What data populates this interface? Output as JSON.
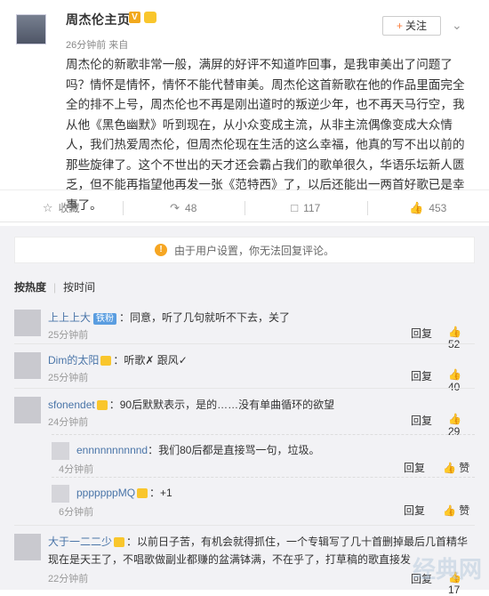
{
  "post": {
    "username": "周杰伦主页",
    "v_badge": "V",
    "meta": "26分钟前 来自",
    "follow_label": "关注",
    "text": "周杰伦的新歌非常一般，满屏的好评不知道咋回事，是我审美出了问题了吗？情怀是情怀，情怀不能代替审美。周杰伦这首新歌在他的作品里面完全全的排不上号，周杰伦也不再是刚出道时的叛逆少年，也不再天马行空，我从他《黑色幽默》听到现在，从小众变成主流，从非主流偶像变成大众情人，我们热爱周杰伦，但周杰伦现在生活的这么幸福，他真的写不出以前的那些旋律了。这个不世出的天才还会霸占我们的歌单很久，华语乐坛新人匮乏，但不能再指望他再发一张《范特西》了，以后还能出一两首好歌已是幸事了。"
  },
  "actions": {
    "favorite": "收藏",
    "repost": "48",
    "comment": "117",
    "like": "453"
  },
  "notice": "由于用户设置，你无法回复评论。",
  "sort": {
    "hot": "按热度",
    "time": "按时间"
  },
  "comments": [
    {
      "name": "上上上大",
      "badge": "铁粉",
      "text": "：同意，听了几句就听不下去，关了",
      "time": "25分钟前",
      "reply": "回复",
      "likes": "52"
    },
    {
      "name": "Dim的太阳",
      "text": "：听歌✗ 跟风✓",
      "time": "25分钟前",
      "reply": "回复",
      "likes": "40"
    },
    {
      "name": "sfonendet",
      "text": "：90后默默表示，是的……没有单曲循环的欲望",
      "time": "24分钟前",
      "reply": "回复",
      "likes": "29"
    },
    {
      "name": "大于一二二少",
      "text": "：以前日子苦，有机会就得抓住，一个专辑写了几十首删掉最后几首精华",
      "text2": "现在是天王了，不唱歌做副业都赚的盆满钵满，不在乎了，打草稿的歌直接发",
      "time": "22分钟前",
      "reply": "回复",
      "likes": "17"
    }
  ],
  "subcomments": [
    {
      "name": "ennnnnnnnnnd",
      "text": "：我们80后都是直接骂一句，垃圾。",
      "time": "4分钟前",
      "reply": "回复",
      "likes": "赞"
    },
    {
      "name": "pppppppMQ",
      "text": "：+1",
      "time": "6分钟前",
      "reply": "回复",
      "likes": "赞"
    }
  ],
  "watermark": "经典网"
}
